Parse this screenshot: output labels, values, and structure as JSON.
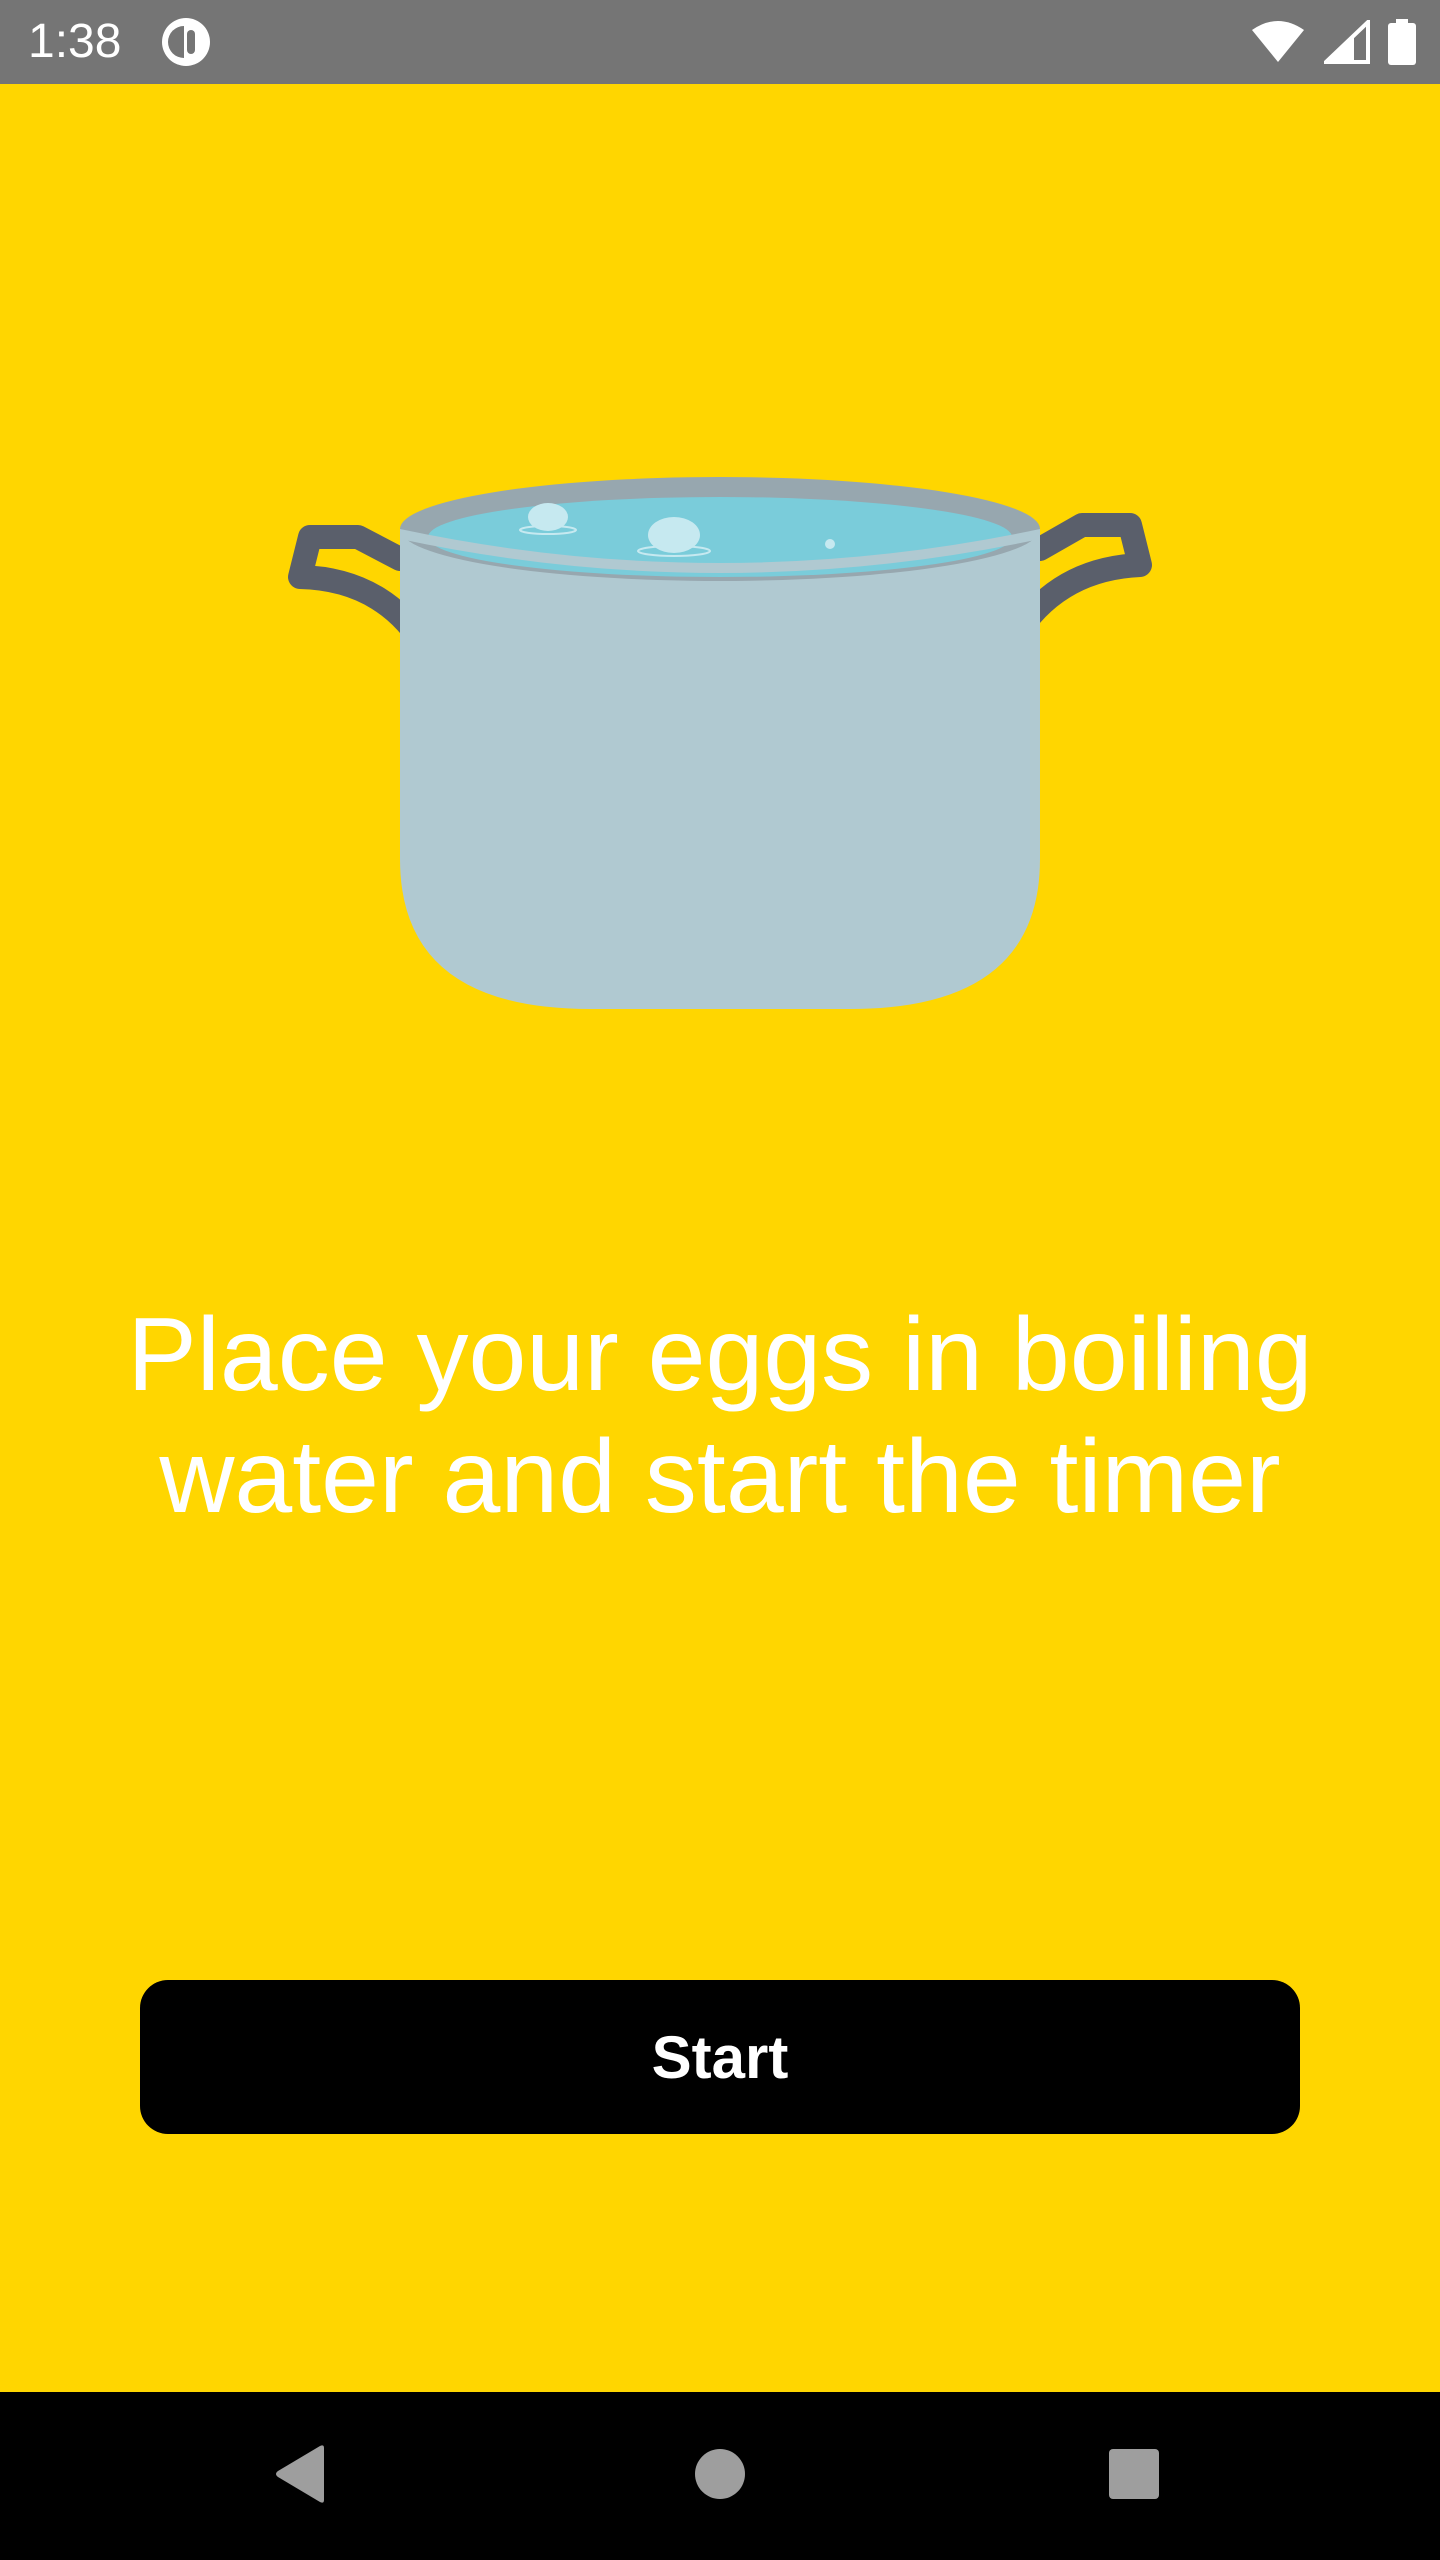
{
  "status_bar": {
    "time": "1:38",
    "app_icon": "app-notification-icon",
    "icons": [
      "wifi-icon",
      "cellular-signal-icon",
      "battery-icon"
    ]
  },
  "main": {
    "illustration": "boiling-pot-icon",
    "message": "Place your eggs in boiling water and start the timer",
    "start_label": "Start"
  },
  "nav_bar": {
    "icons": [
      "back-icon",
      "home-icon",
      "recents-icon"
    ]
  },
  "colors": {
    "background": "#FFD600",
    "status_bar": "#757575",
    "button": "#000000",
    "text": "#FFFFFF"
  }
}
